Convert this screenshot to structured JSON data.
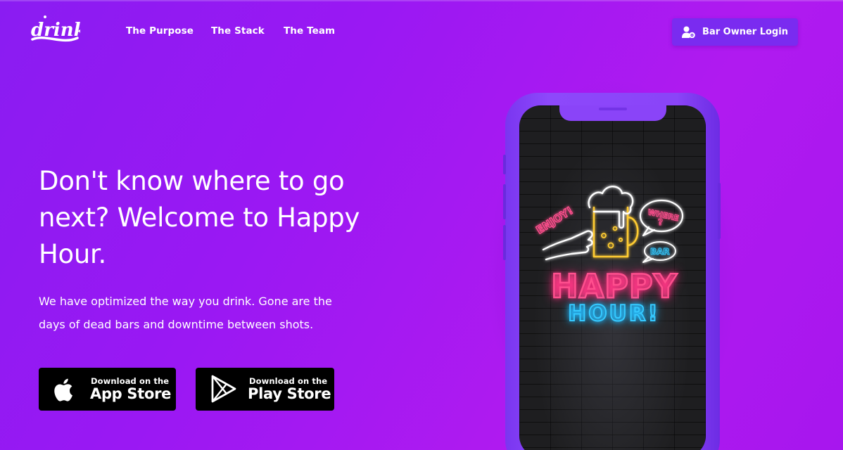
{
  "brand": {
    "logo_text": "drinks"
  },
  "nav": {
    "links": [
      "The Purpose",
      "The Stack",
      "The Team"
    ],
    "login_label": "Bar Owner Login"
  },
  "hero": {
    "title": "Don't know where to go next? Welcome to Happy Hour.",
    "text": "We have optimized the way you drink. Gone are the days of dead bars and downtime between shots."
  },
  "stores": {
    "apple": {
      "small": "Download on the",
      "big": "App Store"
    },
    "google": {
      "small": "Download on the",
      "big": "Play Store"
    }
  },
  "phone_art": {
    "enjoy": "ENJOY!",
    "where": "WHERE ?",
    "bar": "BAR",
    "happy": "HAPPY",
    "hour": "HOUR!"
  },
  "colors": {
    "accent": "#7a2bf0",
    "neon_pink": "#ff4f8e",
    "neon_blue": "#35c9ff",
    "neon_yellow": "#ffcc33"
  }
}
